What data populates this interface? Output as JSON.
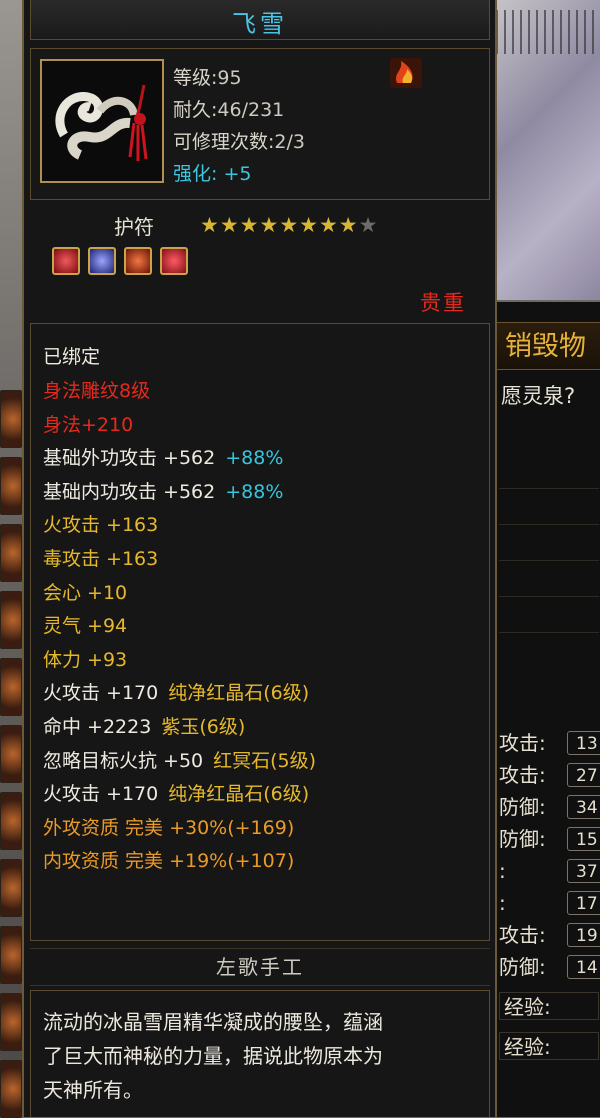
{
  "item": {
    "name": "飞雪",
    "level_label": "等级",
    "level": "95",
    "durability_label": "耐久",
    "durability": "46/231",
    "repair_label": "可修理次数",
    "repair": "2/3",
    "enhance_label": "强化",
    "enhance": "+5",
    "category": "护符",
    "stars_filled": 8,
    "stars_total": 9,
    "rarity": "贵重",
    "bound": "已绑定"
  },
  "attributes": [
    {
      "text": "身法雕纹8级",
      "color": "red"
    },
    {
      "text": "身法+210",
      "color": "red"
    },
    {
      "text": "基础外功攻击  +562",
      "extra": "+88%",
      "color": "white"
    },
    {
      "text": "基础内功攻击  +562",
      "extra": "+88%",
      "color": "white"
    },
    {
      "text": "火攻击  +163",
      "color": "yellow"
    },
    {
      "text": "毒攻击  +163",
      "color": "yellow"
    },
    {
      "text": "会心  +10",
      "color": "yellow"
    },
    {
      "text": "灵气  +94",
      "color": "yellow"
    },
    {
      "text": "体力  +93",
      "color": "yellow"
    },
    {
      "text": "火攻击  +170",
      "extra": "纯净红晶石(6级)",
      "color": "white"
    },
    {
      "text": "命中  +2223",
      "extra": "紫玉(6级)",
      "color": "white"
    },
    {
      "text": "忽略目标火抗  +50",
      "extra": "红冥石(5级)",
      "color": "white"
    },
    {
      "text": "火攻击  +170",
      "extra": "纯净红晶石(6级)",
      "color": "white"
    },
    {
      "text": "外攻资质    完美  +30%(+169)",
      "color": "orange"
    },
    {
      "text": "内攻资质    完美  +19%(+107)",
      "color": "orange"
    }
  ],
  "maker": "左歌手工",
  "description": [
    "流动的冰晶雪眉精华凝成的腰坠，蕴涵",
    "了巨大而神秘的力量，据说此物原本为",
    "天神所有。"
  ],
  "background_panel": {
    "title": "销毁物",
    "question": "愿灵泉?",
    "rows": [
      {
        "label": "攻击:",
        "value": "13"
      },
      {
        "label": "攻击:",
        "value": "27"
      },
      {
        "label": "防御:",
        "value": "34"
      },
      {
        "label": "防御:",
        "value": "15"
      },
      {
        "label": ":",
        "value": "37"
      },
      {
        "label": ":",
        "value": "17"
      },
      {
        "label": "攻击:",
        "value": "19"
      },
      {
        "label": "防御:",
        "value": "14"
      }
    ],
    "exp1": "经验:",
    "exp2": "经验:"
  },
  "colors": {
    "title": "#49c3e6",
    "red": "#e42a1d",
    "yellow": "#e6b82b",
    "cyan": "#31c7df",
    "orange": "#e99a28",
    "star": "#d8b634"
  }
}
